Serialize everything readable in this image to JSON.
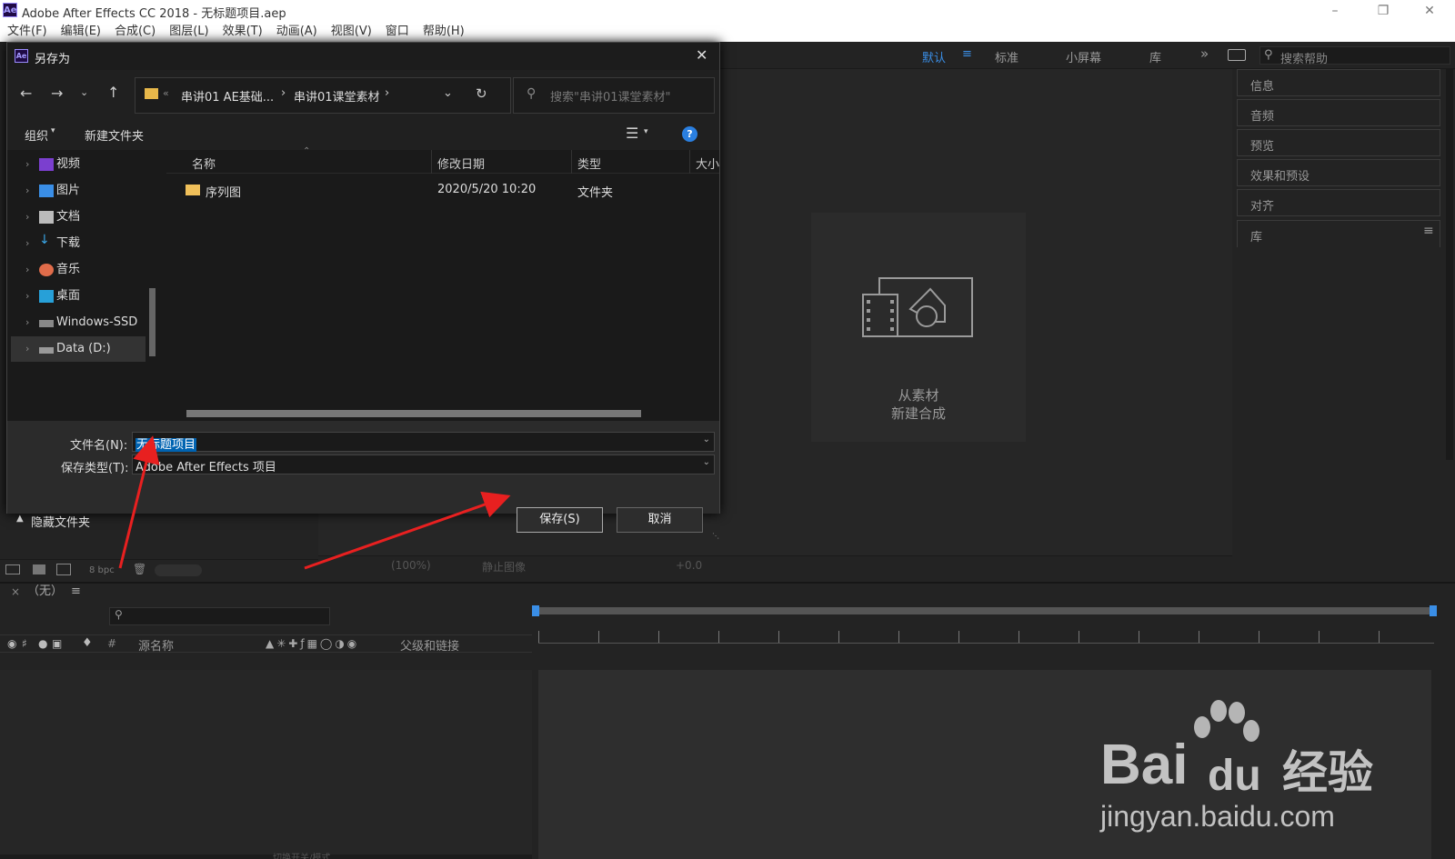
{
  "window": {
    "title": "Adobe After Effects CC 2018 - 无标题项目.aep",
    "logo": "Ae"
  },
  "menu": [
    "文件(F)",
    "编辑(E)",
    "合成(C)",
    "图层(L)",
    "效果(T)",
    "动画(A)",
    "视图(V)",
    "窗口",
    "帮助(H)"
  ],
  "workspace": {
    "default": "默认",
    "standard": "标准",
    "small_screen": "小屏幕",
    "library": "库",
    "search_placeholder": "搜索帮助"
  },
  "right_panels": [
    "信息",
    "音频",
    "预览",
    "效果和预设",
    "对齐",
    "库"
  ],
  "composition": {
    "new_from_footage_line1": "从素材",
    "new_from_footage_line2": "新建合成",
    "zoom": "(100%)",
    "still_image": "静止图像",
    "exposure": "+0.0"
  },
  "project": {
    "bpc": "8 bpc"
  },
  "timeline": {
    "comp_name": "（无）",
    "source_name": "源名称",
    "parent": "父级和链接",
    "hash": "#",
    "toggle_modes": "切换开关/模式"
  },
  "dialog": {
    "title": "另存为",
    "breadcrumb": [
      "串讲01  AE基础...",
      "串讲01课堂素材"
    ],
    "search_placeholder": "搜索\"串讲01课堂素材\"",
    "organize": "组织",
    "new_folder": "新建文件夹",
    "nav_items": [
      "视频",
      "图片",
      "文档",
      "下载",
      "音乐",
      "桌面",
      "Windows-SSD",
      "Data (D:)"
    ],
    "columns": {
      "name": "名称",
      "modified": "修改日期",
      "type": "类型",
      "size": "大小"
    },
    "files": [
      {
        "name": "序列图",
        "modified": "2020/5/20 10:20",
        "type": "文件夹"
      }
    ],
    "filename_label": "文件名(N):",
    "filename_value": "无标题项目",
    "filetype_label": "保存类型(T):",
    "filetype_value": "Adobe After Effects 项目",
    "hide_folders": "隐藏文件夹",
    "save_button": "保存(S)",
    "cancel_button": "取消"
  },
  "watermark": {
    "logo": "Bai",
    "logo2": "du",
    "brand": "经验",
    "url": "jingyan.baidu.com"
  },
  "colors": {
    "accent_blue": "#3a8ee6",
    "annotation_red": "#e82020",
    "selection_blue": "#0063b1"
  }
}
